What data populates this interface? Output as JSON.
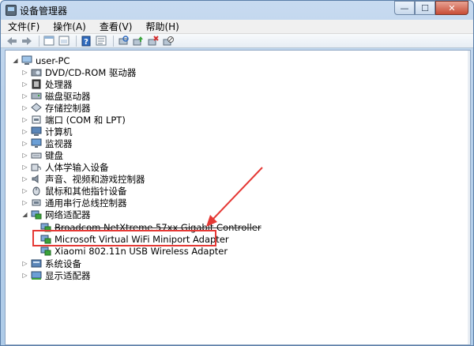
{
  "window": {
    "title": "设备管理器",
    "minimize_glyph": "—",
    "maximize_glyph": "☐",
    "close_glyph": "✕"
  },
  "menu": {
    "items": [
      "文件(F)",
      "操作(A)",
      "查看(V)",
      "帮助(H)"
    ]
  },
  "toolbar": {
    "buttons": [
      "back-icon",
      "forward-icon",
      "properties-icon",
      "show-hide-icon",
      "help-icon",
      "view-icon",
      "scan-hardware-icon",
      "update-driver-icon",
      "uninstall-icon",
      "disable-icon"
    ]
  },
  "tree": {
    "root": "user-PC",
    "items": [
      {
        "label": "DVD/CD-ROM 驱动器",
        "icon": "dvd-drive-icon"
      },
      {
        "label": "处理器",
        "icon": "processor-icon"
      },
      {
        "label": "磁盘驱动器",
        "icon": "disk-drive-icon"
      },
      {
        "label": "存储控制器",
        "icon": "storage-controller-icon"
      },
      {
        "label": "端口 (COM 和 LPT)",
        "icon": "port-icon"
      },
      {
        "label": "计算机",
        "icon": "computer-icon"
      },
      {
        "label": "监视器",
        "icon": "monitor-icon"
      },
      {
        "label": "键盘",
        "icon": "keyboard-icon"
      },
      {
        "label": "人体学输入设备",
        "icon": "hid-icon"
      },
      {
        "label": "声音、视频和游戏控制器",
        "icon": "sound-icon"
      },
      {
        "label": "鼠标和其他指针设备",
        "icon": "mouse-icon"
      },
      {
        "label": "通用串行总线控制器",
        "icon": "usb-icon"
      },
      {
        "label": "网络适配器",
        "icon": "network-adapter-icon",
        "expanded": true
      }
    ],
    "network_children": [
      {
        "label": "Broadcom NetXtreme 57xx Gigabit Controller",
        "icon": "network-card-icon"
      },
      {
        "label": "Microsoft Virtual WiFi Miniport Adapter",
        "icon": "network-card-icon",
        "highlighted": true
      },
      {
        "label": "Xiaomi 802.11n USB Wireless Adapter",
        "icon": "network-card-icon"
      }
    ],
    "after_items": [
      {
        "label": "系统设备",
        "icon": "system-device-icon"
      },
      {
        "label": "显示适配器",
        "icon": "display-adapter-icon"
      }
    ]
  },
  "colors": {
    "annotation_red": "#e53935",
    "title_bar": "#b9d1ea"
  }
}
